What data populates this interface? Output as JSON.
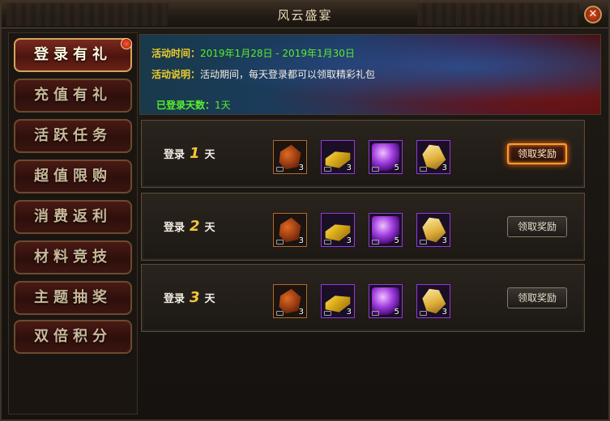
{
  "window": {
    "title": "风云盛宴",
    "close_icon": "close-icon"
  },
  "nav": [
    {
      "label": "登录有礼",
      "active": true,
      "badge": true
    },
    {
      "label": "充值有礼"
    },
    {
      "label": "活跃任务"
    },
    {
      "label": "超值限购"
    },
    {
      "label": "消费返利"
    },
    {
      "label": "材料竞技"
    },
    {
      "label": "主题抽奖"
    },
    {
      "label": "双倍积分"
    }
  ],
  "banner": {
    "time_label": "活动时间：",
    "time_value": "2019年1月28日 - 2019年1月30日",
    "desc_label": "活动说明：",
    "desc_value": "活动期间，每天登录都可以领取精彩礼包",
    "days_label": "已登录天数：",
    "days_value": "1天"
  },
  "rewards": [
    {
      "prefix": "登录",
      "day": "1",
      "suffix": "天",
      "button": "领取奖励",
      "claimable": true,
      "items": [
        {
          "icon": "ore-icon",
          "count": "3"
        },
        {
          "icon": "gold-bar-icon",
          "count": "3"
        },
        {
          "icon": "purple-orb-icon",
          "count": "5"
        },
        {
          "icon": "token-icon",
          "count": "3"
        }
      ]
    },
    {
      "prefix": "登录",
      "day": "2",
      "suffix": "天",
      "button": "领取奖励",
      "claimable": false,
      "items": [
        {
          "icon": "ore-icon",
          "count": "3"
        },
        {
          "icon": "gold-bar-icon",
          "count": "3"
        },
        {
          "icon": "purple-orb-icon",
          "count": "5"
        },
        {
          "icon": "token-icon",
          "count": "3"
        }
      ]
    },
    {
      "prefix": "登录",
      "day": "3",
      "suffix": "天",
      "button": "领取奖励",
      "claimable": false,
      "items": [
        {
          "icon": "ore-icon",
          "count": "3"
        },
        {
          "icon": "gold-bar-icon",
          "count": "3"
        },
        {
          "icon": "purple-orb-icon",
          "count": "5"
        },
        {
          "icon": "token-icon",
          "count": "3"
        }
      ]
    }
  ],
  "colors": {
    "highlight": "#f0cd2a",
    "green": "#59ee2b",
    "active_glow": "#ff9a2e"
  }
}
